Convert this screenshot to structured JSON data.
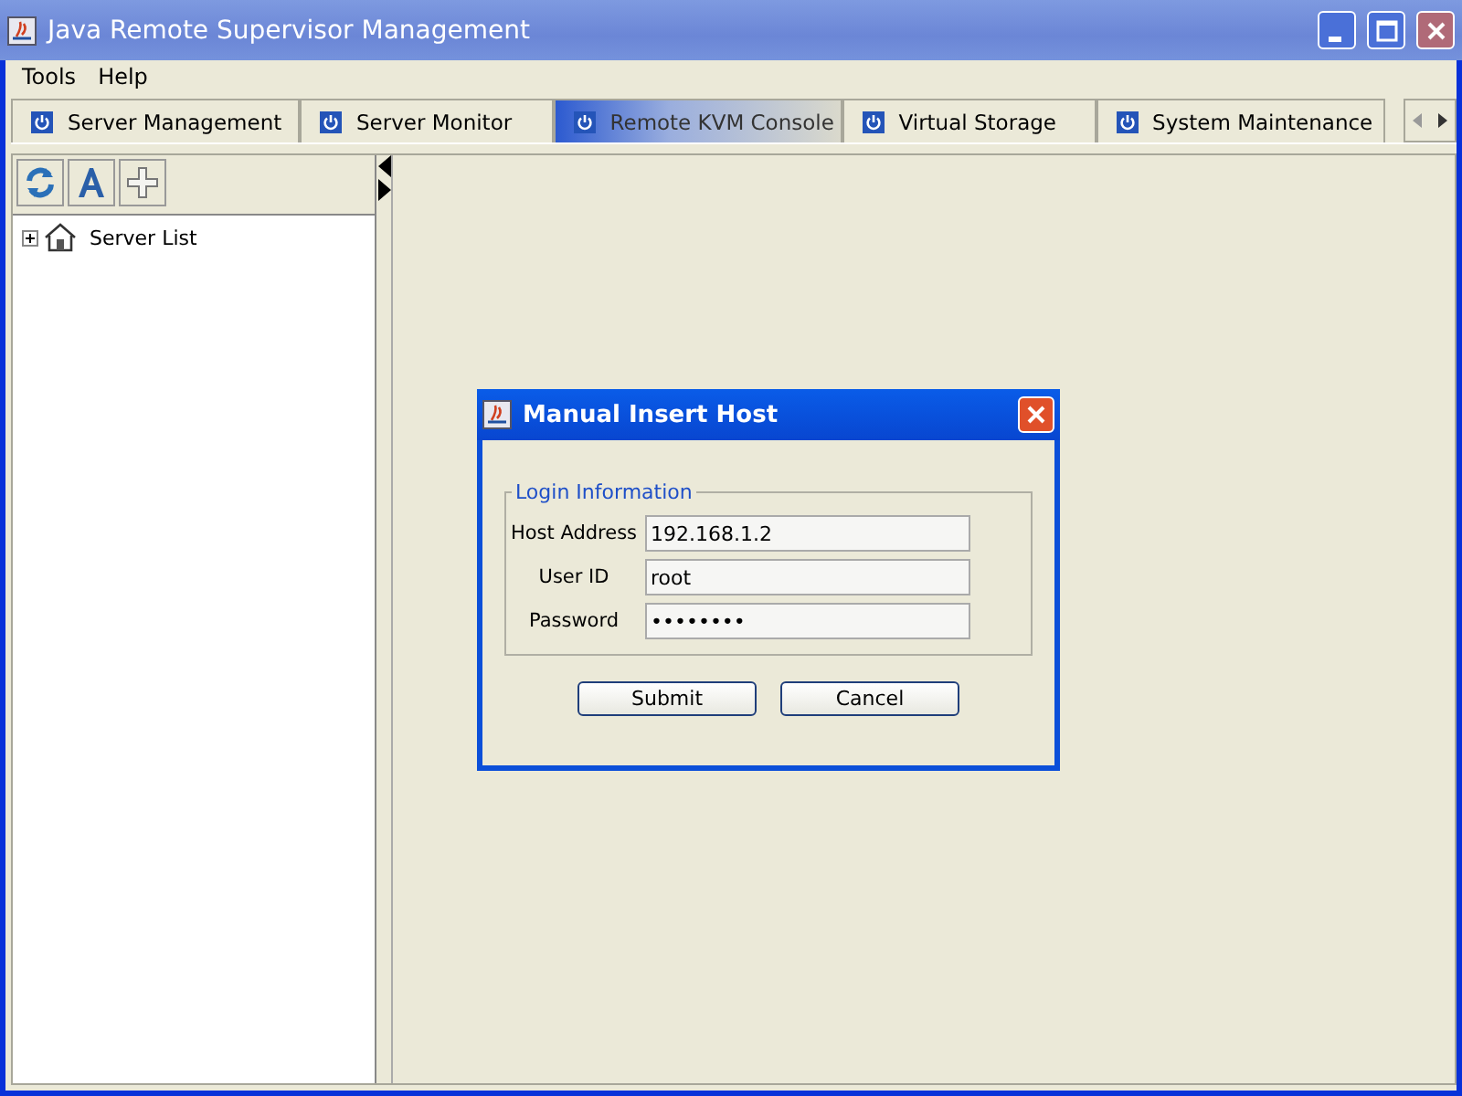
{
  "window": {
    "title": "Java Remote Supervisor Management"
  },
  "menu": [
    "Tools",
    "Help"
  ],
  "tabs": [
    {
      "label": "Server Management",
      "selected": false
    },
    {
      "label": "Server Monitor",
      "selected": false
    },
    {
      "label": "Remote KVM Console",
      "selected": true
    },
    {
      "label": "Virtual Storage",
      "selected": false
    },
    {
      "label": "System Maintenance",
      "selected": false
    }
  ],
  "tree": [
    {
      "label": "Server List",
      "expanded": false
    }
  ],
  "dialog": {
    "title": "Manual Insert Host",
    "group": "Login Information",
    "fields": [
      {
        "label": "Host Address",
        "value": "192.168.1.2"
      },
      {
        "label": "User ID",
        "value": "root"
      },
      {
        "label": "Password",
        "value": "••••••••"
      }
    ],
    "buttons": [
      "Submit",
      "Cancel"
    ]
  }
}
